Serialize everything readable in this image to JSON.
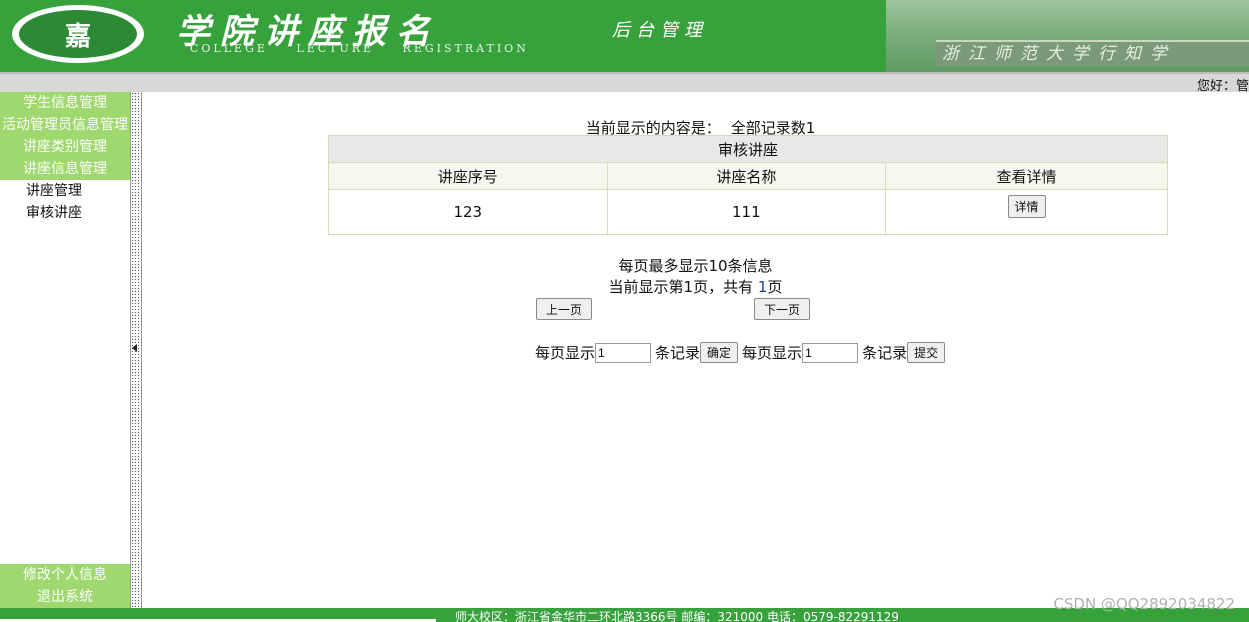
{
  "header": {
    "logo_text": "嘉",
    "title_cn": "学院讲座报名",
    "title_sub": "后台管理",
    "title_en": "COLLEGE LECTURE REGISTRATION",
    "banner_text": "浙江师范大学行知学"
  },
  "topbar": {
    "greeting": "您好：管"
  },
  "sidebar": {
    "menus": [
      {
        "label": "学生信息管理"
      },
      {
        "label": "活动管理员信息管理"
      },
      {
        "label": "讲座类别管理"
      },
      {
        "label": "讲座信息管理"
      }
    ],
    "submenu": [
      {
        "label": "讲座管理"
      },
      {
        "label": "审核讲座"
      }
    ],
    "bottom": [
      {
        "label": "修改个人信息"
      },
      {
        "label": "退出系统"
      }
    ]
  },
  "main": {
    "status_prefix": "当前显示的内容是：",
    "status_value": "全部记录数1",
    "table": {
      "caption": "审核讲座",
      "columns": [
        "讲座序号",
        "讲座名称",
        "查看详情"
      ],
      "rows": [
        {
          "id": "123",
          "name": "111",
          "action": "详情"
        }
      ]
    },
    "per_page_max": "每页最多显示10条信息",
    "page_prefix": "当前显示第1页，共有",
    "page_total": "1",
    "page_suffix": "页",
    "prev_label": "上一页",
    "next_label": "下一页",
    "form": {
      "per_page_label": "每页显示",
      "per_page_value": "1",
      "records_label": "条记录",
      "confirm_label": "确定",
      "per_page_label2": "每页显示",
      "per_page_value2": "1",
      "records_label2": "条记录",
      "submit_label": "提交"
    }
  },
  "footer": {
    "text": "师大校区：浙江省金华市二环北路3366号 邮编：321000 电话：0579-82291129"
  },
  "watermark": "CSDN @QQ2892034822",
  "colors": {
    "brand_green": "#37a13c",
    "menu_green": "#9ed86e"
  }
}
